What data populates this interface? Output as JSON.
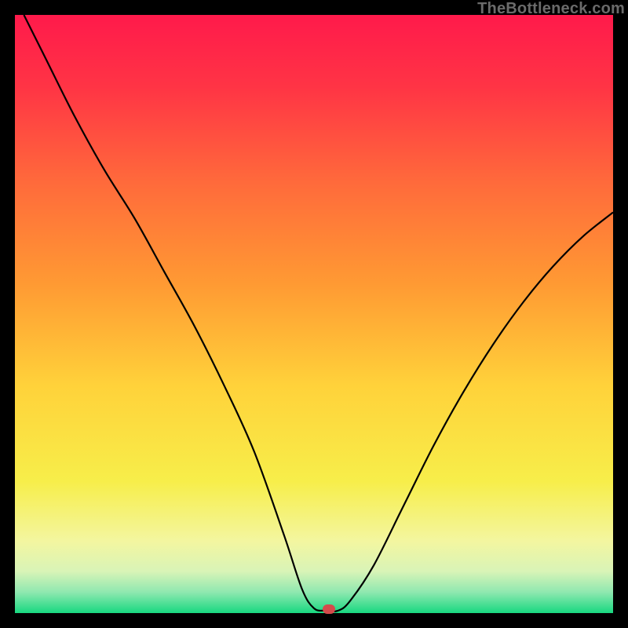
{
  "watermark": "TheBottleneck.com",
  "colors": {
    "marker": "#d54b4b",
    "curve_stroke": "#000000"
  },
  "chart_data": {
    "type": "line",
    "title": "",
    "xlabel": "",
    "ylabel": "",
    "xlim": [
      0,
      100
    ],
    "ylim": [
      0,
      100
    ],
    "gradient_stops": [
      {
        "pos": 0.0,
        "color": "#ff1a4b"
      },
      {
        "pos": 0.12,
        "color": "#ff3445"
      },
      {
        "pos": 0.28,
        "color": "#ff6a3b"
      },
      {
        "pos": 0.45,
        "color": "#ff9a33"
      },
      {
        "pos": 0.62,
        "color": "#ffd23a"
      },
      {
        "pos": 0.78,
        "color": "#f7ee4a"
      },
      {
        "pos": 0.88,
        "color": "#f3f6a0"
      },
      {
        "pos": 0.93,
        "color": "#d9f4b7"
      },
      {
        "pos": 0.965,
        "color": "#8fe8b0"
      },
      {
        "pos": 1.0,
        "color": "#18d880"
      }
    ],
    "series": [
      {
        "name": "bottleneck-curve",
        "x": [
          1.5,
          5,
          10,
          15,
          20,
          25,
          30,
          35,
          40,
          45,
          48,
          50,
          52,
          54,
          56,
          60,
          65,
          70,
          75,
          80,
          85,
          90,
          95,
          100
        ],
        "y": [
          100,
          93,
          83,
          74,
          66,
          57,
          48,
          38,
          27,
          13,
          4,
          0.8,
          0.4,
          0.4,
          2,
          8,
          18,
          28,
          37,
          45,
          52,
          58,
          63,
          67
        ]
      }
    ],
    "marker": {
      "x": 52.5,
      "y": 0.6
    }
  }
}
